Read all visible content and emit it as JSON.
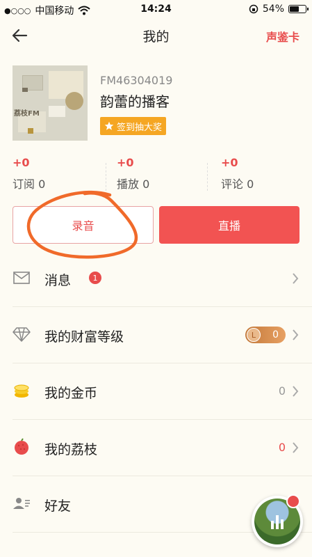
{
  "status_bar": {
    "dots": "●○○○",
    "carrier": "中国移动",
    "time": "14:24",
    "battery": "54%",
    "battery_level": 0.54
  },
  "nav": {
    "title": "我的",
    "right_link": "声鉴卡"
  },
  "profile": {
    "fm_id": "FM46304019",
    "name": "韵蕾的播客",
    "sign_label": "签到抽大奖",
    "cover_brand": "荔枝FM"
  },
  "stats": [
    {
      "delta": "+0",
      "label": "订阅 0"
    },
    {
      "delta": "+0",
      "label": "播放 0"
    },
    {
      "delta": "+0",
      "label": "评论 0"
    }
  ],
  "actions": {
    "record": "录音",
    "live": "直播"
  },
  "menu": {
    "messages": {
      "label": "消息",
      "badge": "1"
    },
    "wealth": {
      "label": "我的财富等级",
      "coin": "L",
      "value": "0"
    },
    "gold": {
      "label": "我的金币",
      "value": "0"
    },
    "lychee": {
      "label": "我的荔枝",
      "value": "0"
    },
    "friends": {
      "label": "好友"
    }
  },
  "colors": {
    "accent": "#e84c4c",
    "badge": "#f5a623",
    "background": "#fdfbf3"
  },
  "icons": [
    "back-arrow-icon",
    "wifi-icon",
    "lock-rotation-icon",
    "star-icon",
    "mail-icon",
    "diamond-icon",
    "coins-icon",
    "lychee-icon",
    "friends-icon",
    "chevron-right-icon",
    "equalizer-icon"
  ]
}
